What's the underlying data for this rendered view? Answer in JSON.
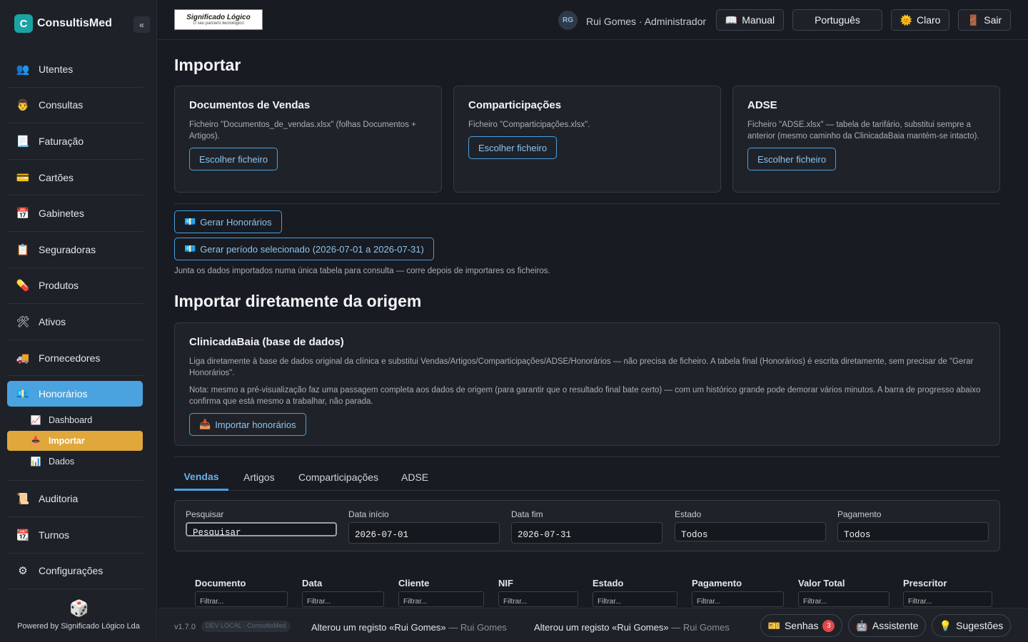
{
  "app": {
    "name": "ConsultisMed",
    "logo_letter": "C",
    "collapse": "«"
  },
  "sidebar": {
    "items": [
      {
        "label": "Utentes",
        "icon": "users-icon",
        "glyph": "👥"
      },
      {
        "label": "Consultas",
        "icon": "doctor-icon",
        "glyph": "👨"
      },
      {
        "label": "Faturação",
        "icon": "invoice-icon",
        "glyph": "📃"
      },
      {
        "label": "Cartões",
        "icon": "card-icon",
        "glyph": "💳"
      },
      {
        "label": "Gabinetes",
        "icon": "calendar-icon",
        "glyph": "📅"
      },
      {
        "label": "Seguradoras",
        "icon": "insurance-icon",
        "glyph": "📋"
      },
      {
        "label": "Produtos",
        "icon": "pill-icon",
        "glyph": "💊"
      },
      {
        "label": "Ativos",
        "icon": "tools-icon",
        "glyph": "🛠"
      },
      {
        "label": "Fornecedores",
        "icon": "truck-icon",
        "glyph": "🚚"
      },
      {
        "label": "Honorários",
        "icon": "money-icon",
        "glyph": "💶"
      }
    ],
    "subitems": [
      {
        "label": "Dashboard",
        "icon": "chart-icon",
        "glyph": "📈"
      },
      {
        "label": "Importar",
        "icon": "import-icon",
        "glyph": "📥"
      },
      {
        "label": "Dados",
        "icon": "data-icon",
        "glyph": "📊"
      }
    ],
    "items_after": [
      {
        "label": "Auditoria",
        "icon": "scroll-icon",
        "glyph": "📜"
      },
      {
        "label": "Turnos",
        "icon": "schedule-icon",
        "glyph": "📆"
      },
      {
        "label": "Configurações",
        "icon": "gear-icon",
        "glyph": "⚙"
      }
    ],
    "powered": "Powered by Significado Lógico Lda"
  },
  "topbar": {
    "brand_name": "Significado Lógico",
    "brand_tagline": "O seu parceiro tecnológico",
    "avatar": "RG",
    "user": "Rui Gomes · Administrador",
    "manual": "Manual",
    "language": "Português",
    "theme": "Claro",
    "logout": "Sair"
  },
  "page": {
    "title": "Importar",
    "cards": [
      {
        "title": "Documentos de Vendas",
        "desc": "Ficheiro \"Documentos_de_vendas.xlsx\" (folhas Documentos + Artigos).",
        "button": "Escolher ficheiro"
      },
      {
        "title": "Comparticipações",
        "desc": "Ficheiro \"Comparticipações.xlsx\".",
        "button": "Escolher ficheiro"
      },
      {
        "title": "ADSE",
        "desc": "Ficheiro \"ADSE.xlsx\" — tabela de tarifário, substitui sempre a anterior (mesmo caminho da ClinicadaBaia mantém-se intacto).",
        "button": "Escolher ficheiro"
      }
    ],
    "gerar": "Gerar Honorários",
    "gerar_periodo": "Gerar período selecionado (2026-07-01 a 2026-07-31)",
    "gerar_note": "Junta os dados importados numa única tabela para consulta — corre depois de importares os ficheiros.",
    "origin_title": "Importar diretamente da origem",
    "origin_card": {
      "title": "ClinicadaBaia (base de dados)",
      "desc1": "Liga diretamente à base de dados original da clínica e substitui Vendas/Artigos/Comparticipações/ADSE/Honorários — não precisa de ficheiro. A tabela final (Honorários) é escrita diretamente, sem precisar de \"Gerar Honorários\".",
      "desc2": "Nota: mesmo a pré-visualização faz uma passagem completa aos dados de origem (para garantir que o resultado final bate certo) — com um histórico grande pode demorar vários minutos. A barra de progresso abaixo confirma que está mesmo a trabalhar, não parada.",
      "button": "Importar honorários"
    },
    "tabs": [
      "Vendas",
      "Artigos",
      "Comparticipações",
      "ADSE"
    ],
    "filters": {
      "search_label": "Pesquisar",
      "search_placeholder": "Pesquisar",
      "start_label": "Data início",
      "start_value": "2026-07-01",
      "end_label": "Data fim",
      "end_value": "2026-07-31",
      "status_label": "Estado",
      "status_value": "Todos",
      "payment_label": "Pagamento",
      "payment_value": "Todos"
    },
    "columns": [
      "Documento",
      "Data",
      "Cliente",
      "NIF",
      "Estado",
      "Pagamento",
      "Valor Total",
      "Prescritor"
    ],
    "column_filter": "Filtrar..."
  },
  "footer": {
    "version": "v1.7.0",
    "env": "DEV LOCAL · ConsultisMed",
    "log1": "Alterou um registo «Rui Gomes»",
    "log1_user": "— Rui Gomes",
    "log2": "Alterou um registo «Rui Gomes»",
    "log2_user": "— Rui Gomes",
    "senhas": "Senhas",
    "senhas_count": "3",
    "assistente": "Assistente",
    "sugestoes": "Sugestões"
  }
}
